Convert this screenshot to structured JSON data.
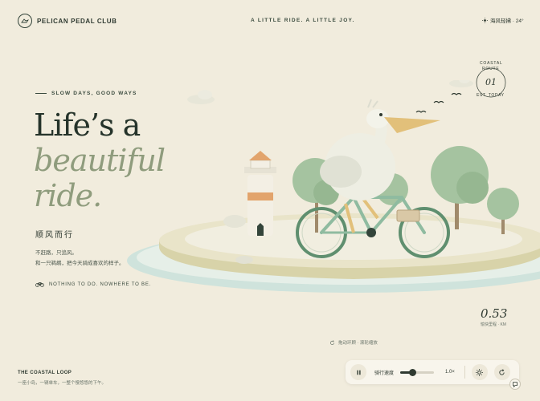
{
  "header": {
    "brand": "PELICAN PEDAL CLUB",
    "tagline": "A LITTLE RIDE. A LITTLE JOY.",
    "weather": "海风轻拂 · 24°"
  },
  "hero": {
    "eyebrow": "SLOW DAYS, GOOD WAYS",
    "line1": "Life’s a",
    "line2": "beautiful",
    "line3": "ride.",
    "cn_title": "顺风而行",
    "cn_desc_1": "不赶路，只追风。",
    "cn_desc_2": "和一只鹈鹕，把今天骑成喜欢的样子。",
    "note": "NOTHING TO DO. NOWHERE TO BE."
  },
  "route_badge": {
    "line1": "COASTAL",
    "line2": "ROUTE",
    "number": "01",
    "line3": "EST. TODAY"
  },
  "distance": {
    "value": "0.53",
    "label": "愉快里程 · KM"
  },
  "hint": "拖动环顾 · 滚轮缩放",
  "footer": {
    "title": "THE COASTAL LOOP",
    "desc": "一座小岛，一辆单车，一整个慢悠悠的下午。"
  },
  "controls": {
    "speed_label": "骑行速度",
    "speed_value": "1.0×",
    "speed_fraction": 0.35,
    "pause_icon": "pause-icon",
    "sun_icon": "sun-icon",
    "reset_icon": "reset-icon"
  },
  "colors": {
    "background": "#f1ecdd",
    "accent_dark": "#25332a",
    "accent_sage": "#8f9c7d",
    "bike_green": "#5f8f6f",
    "beak_yellow": "#e2c07a"
  }
}
